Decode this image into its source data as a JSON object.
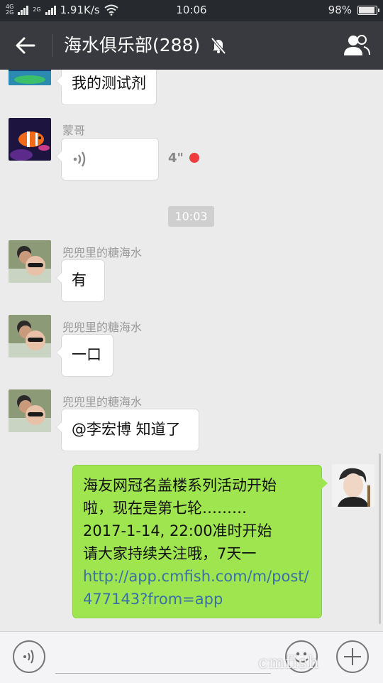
{
  "status_bar": {
    "network_top": "4G",
    "network_bottom": "2G",
    "network2_top": "2G",
    "speed": "1.91K/s",
    "time": "10:06",
    "battery_percent": "98%",
    "battery_level": 0.98
  },
  "header": {
    "title": "海水俱乐部(288)",
    "icons": [
      "back-arrow-icon",
      "mute-bell-icon",
      "group-members-icon"
    ]
  },
  "messages": [
    {
      "type": "text",
      "side": "left",
      "sender": "",
      "text": "我的测试剂"
    },
    {
      "type": "voice",
      "side": "left",
      "sender": "蒙哥",
      "duration": "4\"",
      "unread": true
    },
    {
      "type": "time",
      "text": "10:03"
    },
    {
      "type": "text",
      "side": "left",
      "sender": "兜兜里的糖海水",
      "text": "有"
    },
    {
      "type": "text",
      "side": "left",
      "sender": "兜兜里的糖海水",
      "text": "一口"
    },
    {
      "type": "text",
      "side": "left",
      "sender": "兜兜里的糖海水",
      "text": "@李宏博 知道了"
    },
    {
      "type": "text",
      "side": "right",
      "lines": [
        "海友网冠名盖楼系列活动开始",
        "啦，现在是第七轮………",
        "2017-1-14, 22:00准时开始",
        "请大家持续关注哦，7天一"
      ],
      "link": "http://app.cmfish.com/m/post/477143?from=app"
    }
  ],
  "input_bar": {
    "icons": [
      "voice-input-icon",
      "emoji-icon",
      "plus-icon"
    ]
  },
  "watermark": "cmfish",
  "colors": {
    "status_bar": "#26292e",
    "title_bar": "#393a3f",
    "chat_bg": "#ebebeb",
    "own_bubble": "#9ee54f",
    "link": "#3a6fa8",
    "unread_dot": "#ee3b3b"
  }
}
